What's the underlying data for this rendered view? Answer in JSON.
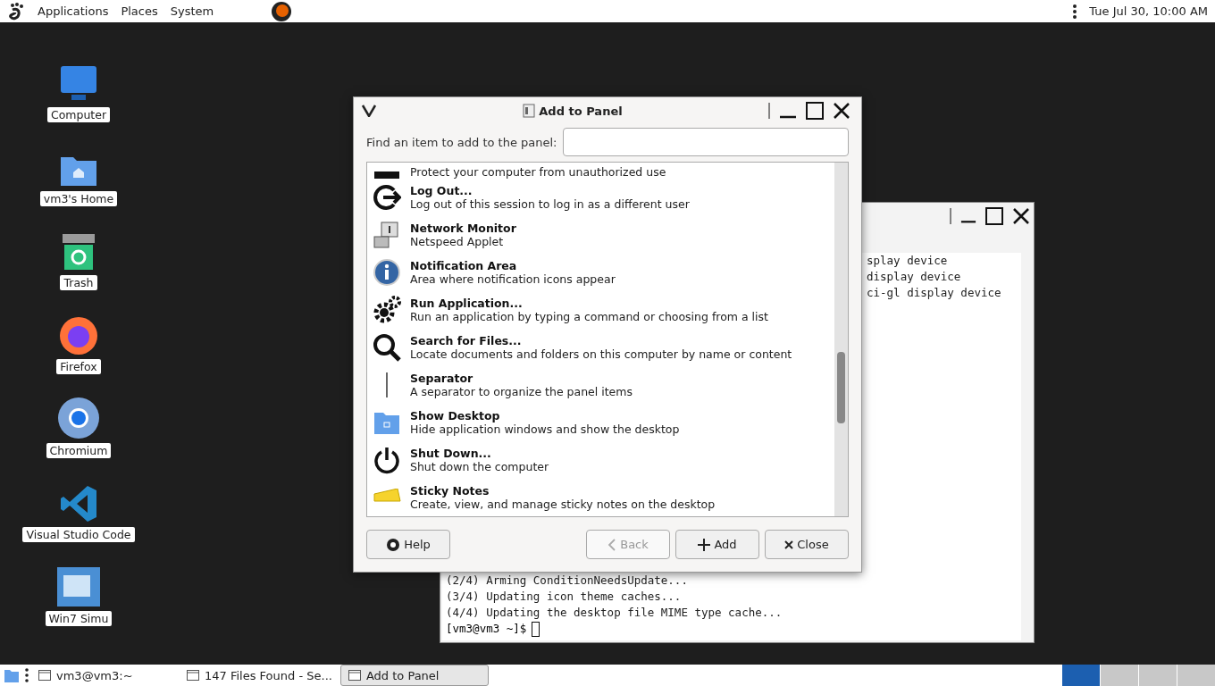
{
  "top_panel": {
    "menus": [
      "Applications",
      "Places",
      "System"
    ],
    "clock": "Tue Jul 30, 10:00 AM"
  },
  "desktop_icons": [
    {
      "label": "Computer",
      "kind": "computer"
    },
    {
      "label": "vm3's Home",
      "kind": "home"
    },
    {
      "label": "Trash",
      "kind": "trash"
    },
    {
      "label": "Firefox",
      "kind": "firefox"
    },
    {
      "label": "Chromium",
      "kind": "chromium"
    },
    {
      "label": "Visual Studio Code",
      "kind": "vscode"
    },
    {
      "label": "Win7 Simu",
      "kind": "win7"
    }
  ],
  "terminal": {
    "cut_lines": [
      "splay device",
      "display device",
      "ci-gl display device"
    ],
    "lines": [
      "(2/4) Arming ConditionNeedsUpdate...",
      "(3/4) Updating icon theme caches...",
      "(4/4) Updating the desktop file MIME type cache..."
    ],
    "prompt": "[vm3@vm3 ~]$"
  },
  "dialog": {
    "title": "Add to Panel",
    "search": {
      "label": "Find an item to add to the panel:"
    },
    "items": [
      {
        "kind": "lock",
        "description": "Protect your computer from unauthorized use"
      },
      {
        "kind": "logout",
        "title": "Log Out...",
        "description": "Log out of this session to log in as a different user"
      },
      {
        "kind": "network",
        "title": "Network Monitor",
        "description": "Netspeed Applet"
      },
      {
        "kind": "info",
        "title": "Notification Area",
        "description": "Area where notification icons appear"
      },
      {
        "kind": "gear",
        "title": "Run Application...",
        "description": "Run an application by typing a command or choosing from a list"
      },
      {
        "kind": "search",
        "title": "Search for Files...",
        "description": "Locate documents and folders on this computer by name or content"
      },
      {
        "kind": "separator",
        "title": "Separator",
        "description": "A separator to organize the panel items"
      },
      {
        "kind": "desktop",
        "title": "Show Desktop",
        "description": "Hide application windows and show the desktop"
      },
      {
        "kind": "power",
        "title": "Shut Down...",
        "description": "Shut down the computer"
      },
      {
        "kind": "note",
        "title": "Sticky Notes",
        "description": "Create, view, and manage sticky notes on the desktop"
      }
    ],
    "buttons": [
      {
        "kind": "help",
        "label": "Help",
        "disabled": false
      },
      {
        "kind": "back",
        "label": "Back",
        "disabled": true
      },
      {
        "kind": "add",
        "label": "Add",
        "disabled": false
      },
      {
        "kind": "close",
        "label": "Close",
        "disabled": false
      }
    ]
  },
  "taskbar": {
    "items": [
      {
        "label": "vm3@vm3:~",
        "selected": false
      },
      {
        "label": "147 Files Found - Se...",
        "selected": false
      },
      {
        "label": "Add to Panel",
        "selected": true
      }
    ],
    "workspaces": [
      {
        "selected": true
      },
      {
        "selected": false
      },
      {
        "selected": false
      },
      {
        "selected": false
      }
    ]
  }
}
